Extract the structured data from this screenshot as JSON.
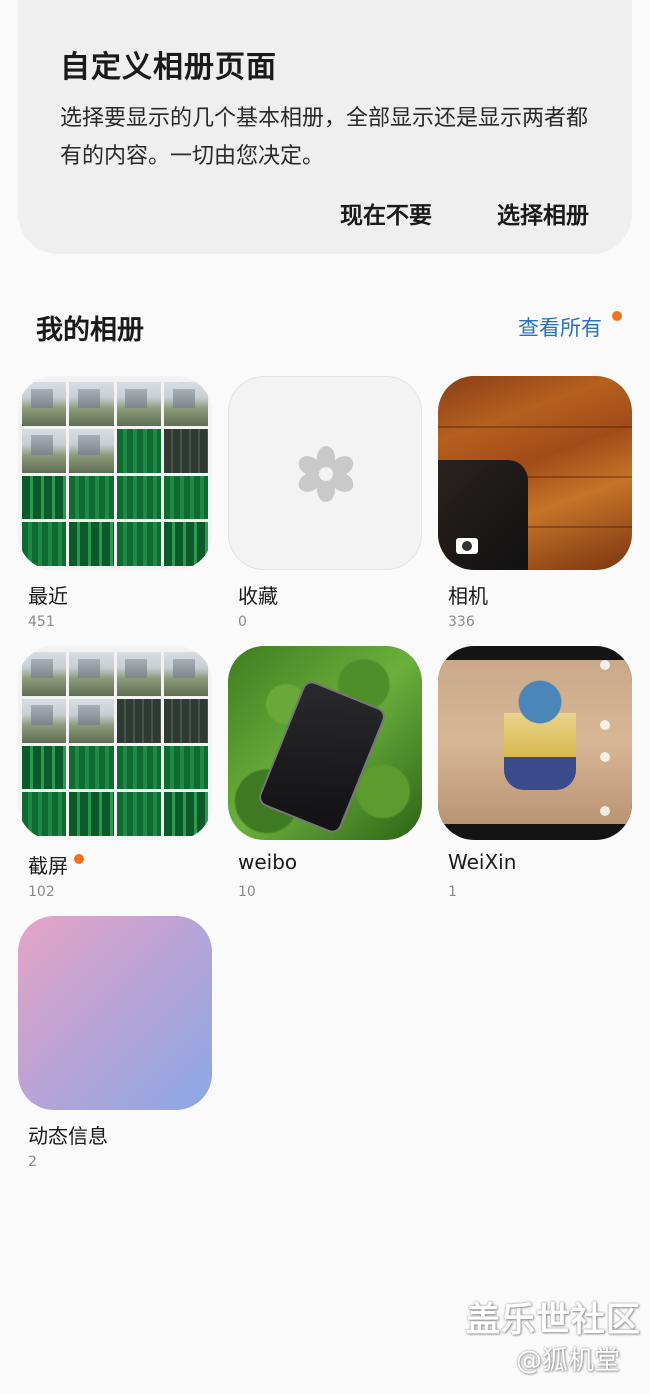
{
  "card": {
    "title": "自定义相册页面",
    "body": "选择要显示的几个基本相册，全部显示还是显示两者都有的内容。一切由您决定。",
    "later_label": "现在不要",
    "choose_label": "选择相册"
  },
  "section": {
    "title": "我的相册",
    "view_all": "查看所有"
  },
  "albums": [
    {
      "name": "最近",
      "count": "451"
    },
    {
      "name": "收藏",
      "count": "0"
    },
    {
      "name": "相机",
      "count": "336"
    },
    {
      "name": "截屏",
      "count": "102"
    },
    {
      "name": "weibo",
      "count": "10"
    },
    {
      "name": "WeiXin",
      "count": "1"
    },
    {
      "name": "动态信息",
      "count": "2"
    }
  ],
  "watermark": {
    "main": "盖乐世社区",
    "sub": "@狐机堂"
  },
  "colors": {
    "accent_link": "#2b6fc0",
    "notification_dot": "#f0701e",
    "card_bg": "#efefef"
  },
  "icons": {
    "favorites_placeholder": "flower-icon",
    "camera_badge": "camera-icon"
  }
}
